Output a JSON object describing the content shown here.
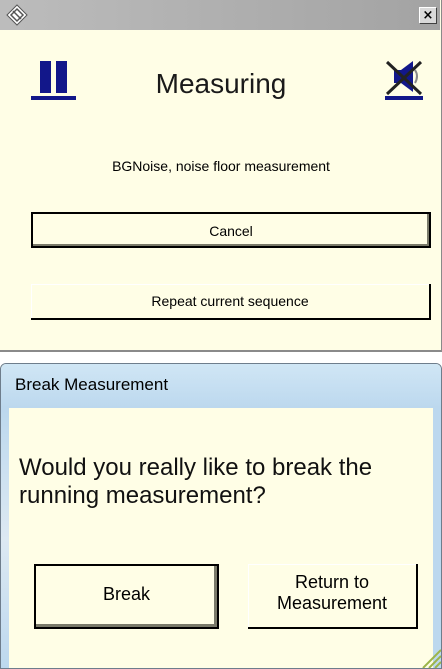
{
  "dialog1": {
    "close_glyph": "×",
    "title": "Measuring",
    "subtitle": "BGNoise, noise floor measurement",
    "cancel_label": "Cancel",
    "repeat_label": "Repeat current sequence",
    "icons": {
      "app": "app-diamond-icon",
      "pause": "pause-icon",
      "speaker": "speaker-mute-icon"
    }
  },
  "dialog2": {
    "title": "Break Measurement",
    "question": "Would you really like to break the running measurement?",
    "break_label": "Break",
    "return_line1": "Return to",
    "return_line2": "Measurement"
  },
  "colors": {
    "dialog_background": "#fffee6",
    "pause_blue": "#12178a",
    "titlebar_grey": "#a3a3a3",
    "titlebar_blue": "#bcd8ee"
  }
}
